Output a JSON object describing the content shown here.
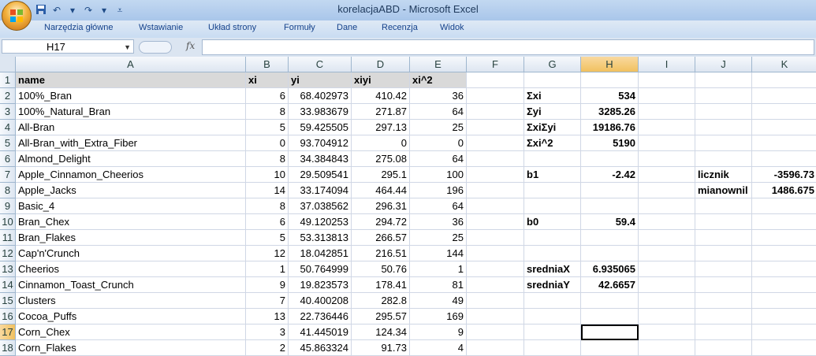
{
  "window": {
    "title": "korelacjaABD - Microsoft Excel"
  },
  "ribbon": {
    "tabs": [
      "Narzędzia główne",
      "Wstawianie",
      "Układ strony",
      "Formuły",
      "Dane",
      "Recenzja",
      "Widok"
    ]
  },
  "formula_bar": {
    "name_box": "H17",
    "fx": "fx",
    "formula": ""
  },
  "sheet": {
    "columns": [
      "A",
      "B",
      "C",
      "D",
      "E",
      "F",
      "G",
      "H",
      "I",
      "J",
      "K"
    ],
    "active_column": "H",
    "active_row": "17",
    "row_numbers": [
      "1",
      "2",
      "3",
      "4",
      "5",
      "6",
      "7",
      "8",
      "9",
      "10",
      "11",
      "12",
      "13",
      "14",
      "15",
      "16",
      "17",
      "18"
    ],
    "rows": [
      [
        "name",
        "xi",
        "yi",
        "xiyi",
        "xi^2",
        "",
        "",
        "",
        "",
        "",
        ""
      ],
      [
        "100%_Bran",
        "6",
        "68.402973",
        "410.42",
        "36",
        "",
        "Σxi",
        "534",
        "",
        "",
        ""
      ],
      [
        "100%_Natural_Bran",
        "8",
        "33.983679",
        "271.87",
        "64",
        "",
        "Σyi",
        "3285.26",
        "",
        "",
        ""
      ],
      [
        "All-Bran",
        "5",
        "59.425505",
        "297.13",
        "25",
        "",
        "ΣxiΣyi",
        "19186.76",
        "",
        "",
        ""
      ],
      [
        "All-Bran_with_Extra_Fiber",
        "0",
        "93.704912",
        "0",
        "0",
        "",
        "Σxi^2",
        "5190",
        "",
        "",
        ""
      ],
      [
        "Almond_Delight",
        "8",
        "34.384843",
        "275.08",
        "64",
        "",
        "",
        "",
        "",
        "",
        ""
      ],
      [
        "Apple_Cinnamon_Cheerios",
        "10",
        "29.509541",
        "295.1",
        "100",
        "",
        "b1",
        "-2.42",
        "",
        "licznik",
        "-3596.73"
      ],
      [
        "Apple_Jacks",
        "14",
        "33.174094",
        "464.44",
        "196",
        "",
        "",
        "",
        "",
        "mianownil",
        "1486.675"
      ],
      [
        "Basic_4",
        "8",
        "37.038562",
        "296.31",
        "64",
        "",
        "",
        "",
        "",
        "",
        ""
      ],
      [
        "Bran_Chex",
        "6",
        "49.120253",
        "294.72",
        "36",
        "",
        "b0",
        "59.4",
        "",
        "",
        ""
      ],
      [
        "Bran_Flakes",
        "5",
        "53.313813",
        "266.57",
        "25",
        "",
        "",
        "",
        "",
        "",
        ""
      ],
      [
        "Cap'n'Crunch",
        "12",
        "18.042851",
        "216.51",
        "144",
        "",
        "",
        "",
        "",
        "",
        ""
      ],
      [
        "Cheerios",
        "1",
        "50.764999",
        "50.76",
        "1",
        "",
        "sredniaX",
        "6.935065",
        "",
        "",
        ""
      ],
      [
        "Cinnamon_Toast_Crunch",
        "9",
        "19.823573",
        "178.41",
        "81",
        "",
        "sredniaY",
        "42.6657",
        "",
        "",
        ""
      ],
      [
        "Clusters",
        "7",
        "40.400208",
        "282.8",
        "49",
        "",
        "",
        "",
        "",
        "",
        ""
      ],
      [
        "Cocoa_Puffs",
        "13",
        "22.736446",
        "295.57",
        "169",
        "",
        "",
        "",
        "",
        "",
        ""
      ],
      [
        "Corn_Chex",
        "3",
        "41.445019",
        "124.34",
        "9",
        "",
        "",
        "",
        "",
        "",
        ""
      ],
      [
        "Corn_Flakes",
        "2",
        "45.863324",
        "91.73",
        "4",
        "",
        "",
        "",
        "",
        "",
        ""
      ]
    ]
  }
}
